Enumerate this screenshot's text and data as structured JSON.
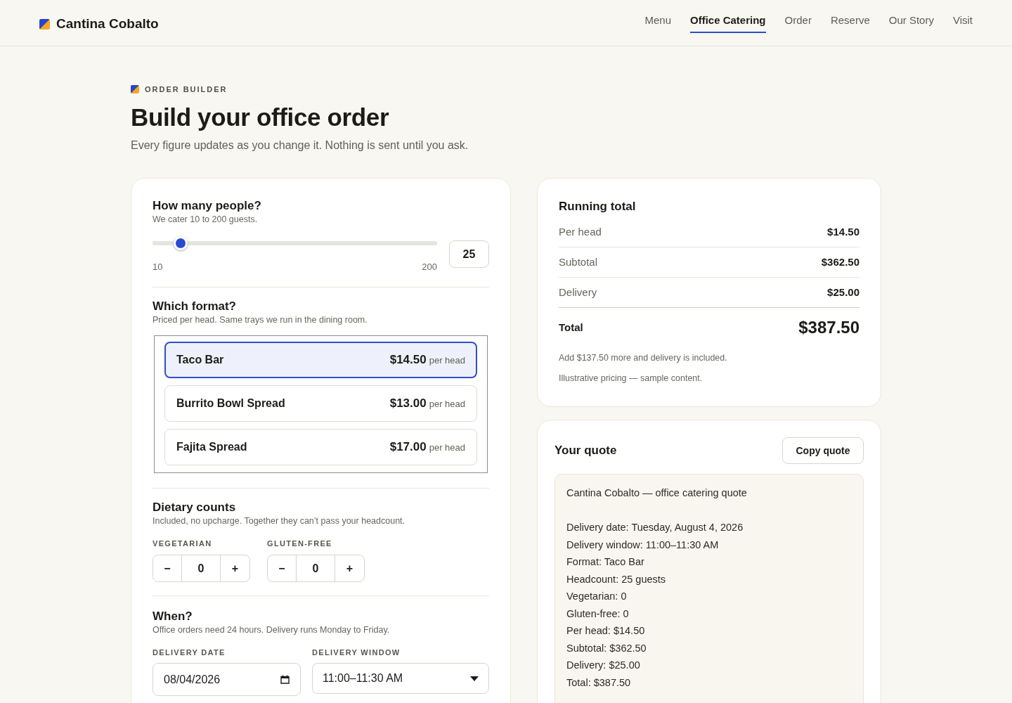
{
  "header": {
    "brand": "Cantina Cobalto",
    "nav": [
      {
        "label": "Menu",
        "selected": false
      },
      {
        "label": "Office Catering",
        "selected": true
      },
      {
        "label": "Order",
        "selected": false
      },
      {
        "label": "Reserve",
        "selected": false
      },
      {
        "label": "Our Story",
        "selected": false
      },
      {
        "label": "Visit",
        "selected": false
      }
    ]
  },
  "intro": {
    "eyebrow": "ORDER BUILDER",
    "title": "Build your office order",
    "subtitle": "Every figure updates as you change it. Nothing is sent until you ask."
  },
  "headcount": {
    "title": "How many people?",
    "hint": "We cater 10 to 200 guests.",
    "level": 0.079,
    "min_label": "10",
    "max_label": "200",
    "value": "25"
  },
  "format": {
    "title": "Which format?",
    "hint": "Priced per head. Same trays we run in the dining room.",
    "options": [
      {
        "name": "Taco Bar",
        "price": "$14.50",
        "unit": "per head",
        "selected": true
      },
      {
        "name": "Burrito Bowl Spread",
        "price": "$13.00",
        "unit": "per head",
        "selected": false
      },
      {
        "name": "Fajita Spread",
        "price": "$17.00",
        "unit": "per head",
        "selected": false
      }
    ]
  },
  "dietary": {
    "title": "Dietary counts",
    "hint": "Included, no upcharge. Together they can’t pass your headcount.",
    "counters": [
      {
        "label": "VEGETARIAN",
        "decrement": "−",
        "value": "0",
        "increment": "+"
      },
      {
        "label": "GLUTEN-FREE",
        "decrement": "−",
        "value": "0",
        "increment": "+"
      }
    ]
  },
  "when": {
    "title": "When?",
    "hint": "Office orders need 24 hours. Delivery runs Monday to Friday.",
    "fields": [
      {
        "kind": "date",
        "label": "DELIVERY DATE",
        "value": "08/04/2026"
      },
      {
        "kind": "select",
        "label": "DELIVERY WINDOW",
        "value": "11:00–11:30 AM"
      }
    ]
  },
  "running_total": {
    "title": "Running total",
    "rows": [
      {
        "label": "Per head",
        "value": "$14.50"
      },
      {
        "label": "Subtotal",
        "value": "$362.50"
      },
      {
        "label": "Delivery",
        "value": "$25.00"
      }
    ],
    "total": {
      "label": "Total",
      "value": "$387.50"
    },
    "notes": [
      "Add $137.50 more and delivery is included.",
      "Illustrative pricing — sample content."
    ]
  },
  "quote": {
    "title": "Your quote",
    "copy_button": "Copy quote",
    "heading": "Cantina Cobalto — office catering quote",
    "lines": [
      "Delivery date: Tuesday, August 4, 2026",
      "Delivery window: 11:00–11:30 AM",
      "Format: Taco Bar",
      "Headcount: 25 guests",
      "Vegetarian: 0",
      "Gluten-free: 0",
      "Per head: $14.50",
      "Subtotal: $362.50",
      "Delivery: $25.00",
      "Total: $387.50"
    ]
  }
}
